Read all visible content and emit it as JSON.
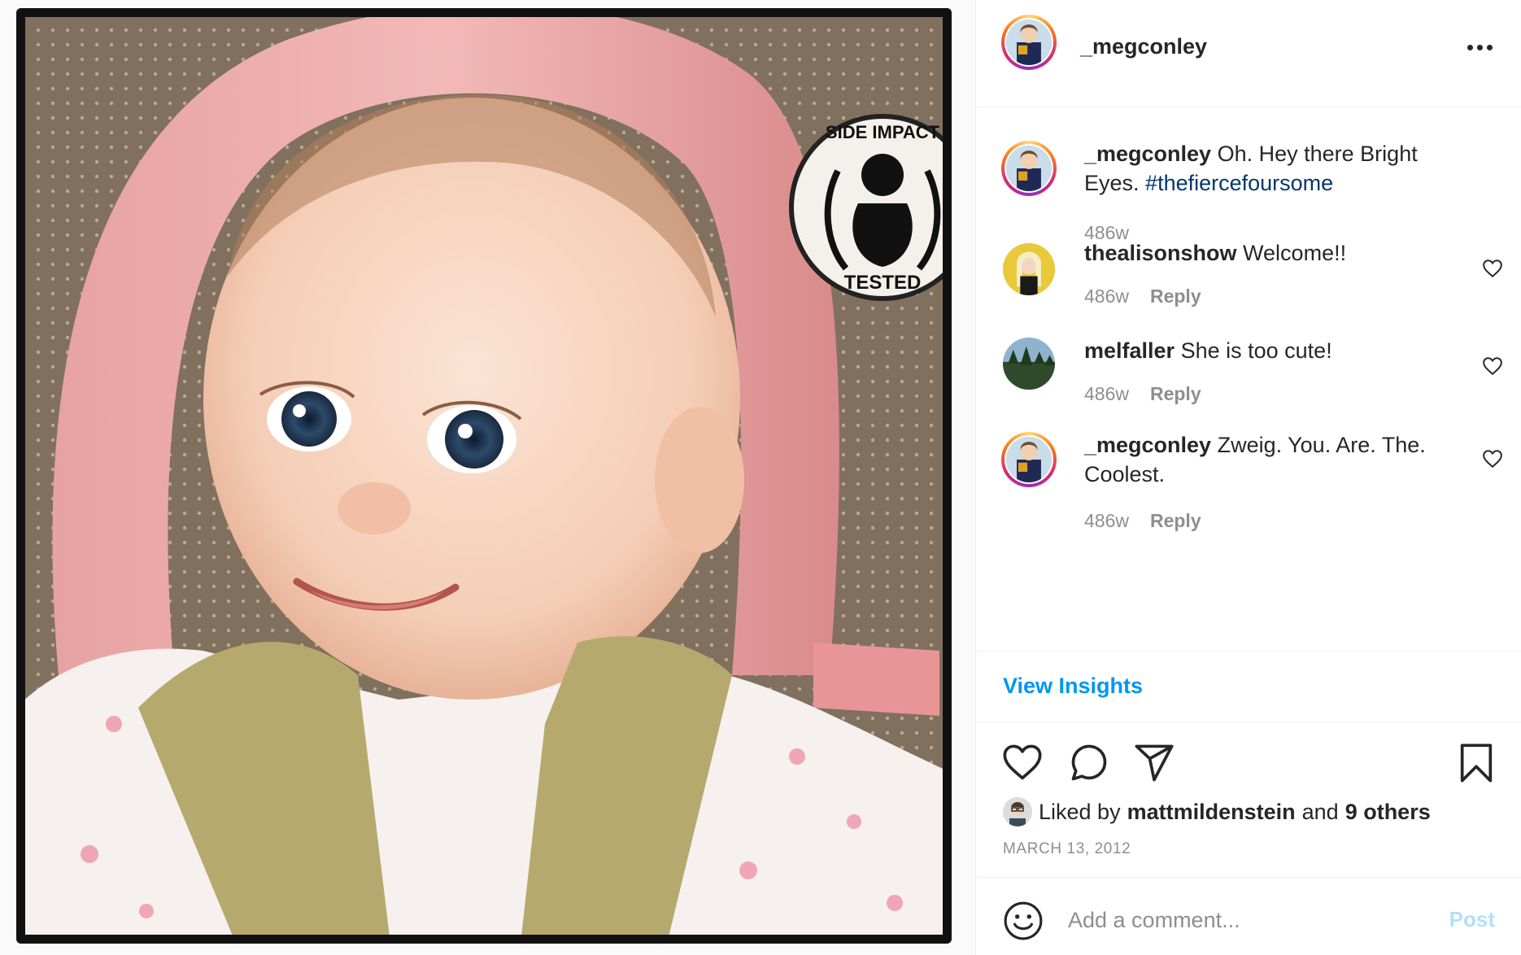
{
  "post": {
    "username": "_megconley",
    "more_icon": "more-horizontal-icon"
  },
  "caption": {
    "username": "_megconley",
    "text": "Oh. Hey there Bright Eyes.",
    "hashtag": "#thefiercefoursome",
    "age": "486w"
  },
  "comments": [
    {
      "username": "thealisonshow",
      "text": "Welcome!!",
      "age": "486w",
      "reply_label": "Reply"
    },
    {
      "username": "melfaller",
      "text": "She is too cute!",
      "age": "486w",
      "reply_label": "Reply"
    },
    {
      "username": "_megconley",
      "text": "Zweig. You. Are. The. Coolest.",
      "age": "486w",
      "reply_label": "Reply"
    }
  ],
  "insights": {
    "label": "View Insights"
  },
  "actions": {
    "icons": [
      "heart-icon",
      "comment-icon",
      "share-icon",
      "bookmark-icon"
    ]
  },
  "likes": {
    "prefix": "Liked by",
    "user": "mattmildenstein",
    "connector": "and",
    "others": "9 others"
  },
  "date": "MARCH 13, 2012",
  "comment_box": {
    "placeholder": "Add a comment...",
    "post_label": "Post"
  },
  "photo_badge": {
    "top_text": "SIDE IMPACT",
    "bottom_text": "TESTED"
  },
  "colors": {
    "link_blue": "#0095f6",
    "hashtag_blue": "#00376b",
    "post_disabled": "#b2dffc",
    "muted": "#8e8e8e"
  }
}
